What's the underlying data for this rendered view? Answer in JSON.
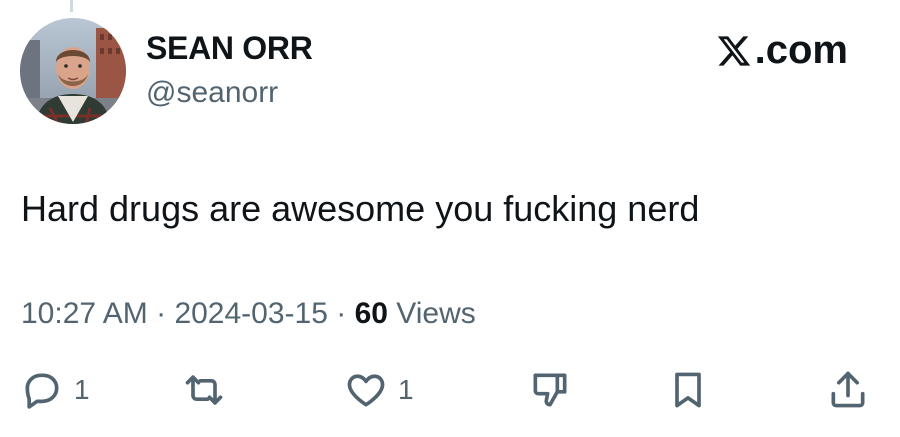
{
  "author": {
    "display_name": "SEAN ORR",
    "handle": "@seanorr"
  },
  "brand": {
    "label": ".com",
    "icon": "x-logo-icon"
  },
  "tweet": {
    "text": "Hard drugs are awesome you fucking nerd",
    "time": "10:27 AM",
    "separator_1": " · ",
    "date": "2024-03-15",
    "separator_2": " · ",
    "views_count": "60",
    "views_label": " Views"
  },
  "actions": {
    "reply": {
      "icon": "reply-icon",
      "count": "1"
    },
    "retweet": {
      "icon": "retweet-icon"
    },
    "like": {
      "icon": "heart-icon",
      "count": "1"
    },
    "dislike": {
      "icon": "thumbs-down-icon"
    },
    "bookmark": {
      "icon": "bookmark-icon"
    },
    "share": {
      "icon": "share-icon"
    }
  },
  "colors": {
    "text_primary": "#0f1419",
    "text_secondary": "#536471",
    "thread_line": "#cfd9de"
  }
}
